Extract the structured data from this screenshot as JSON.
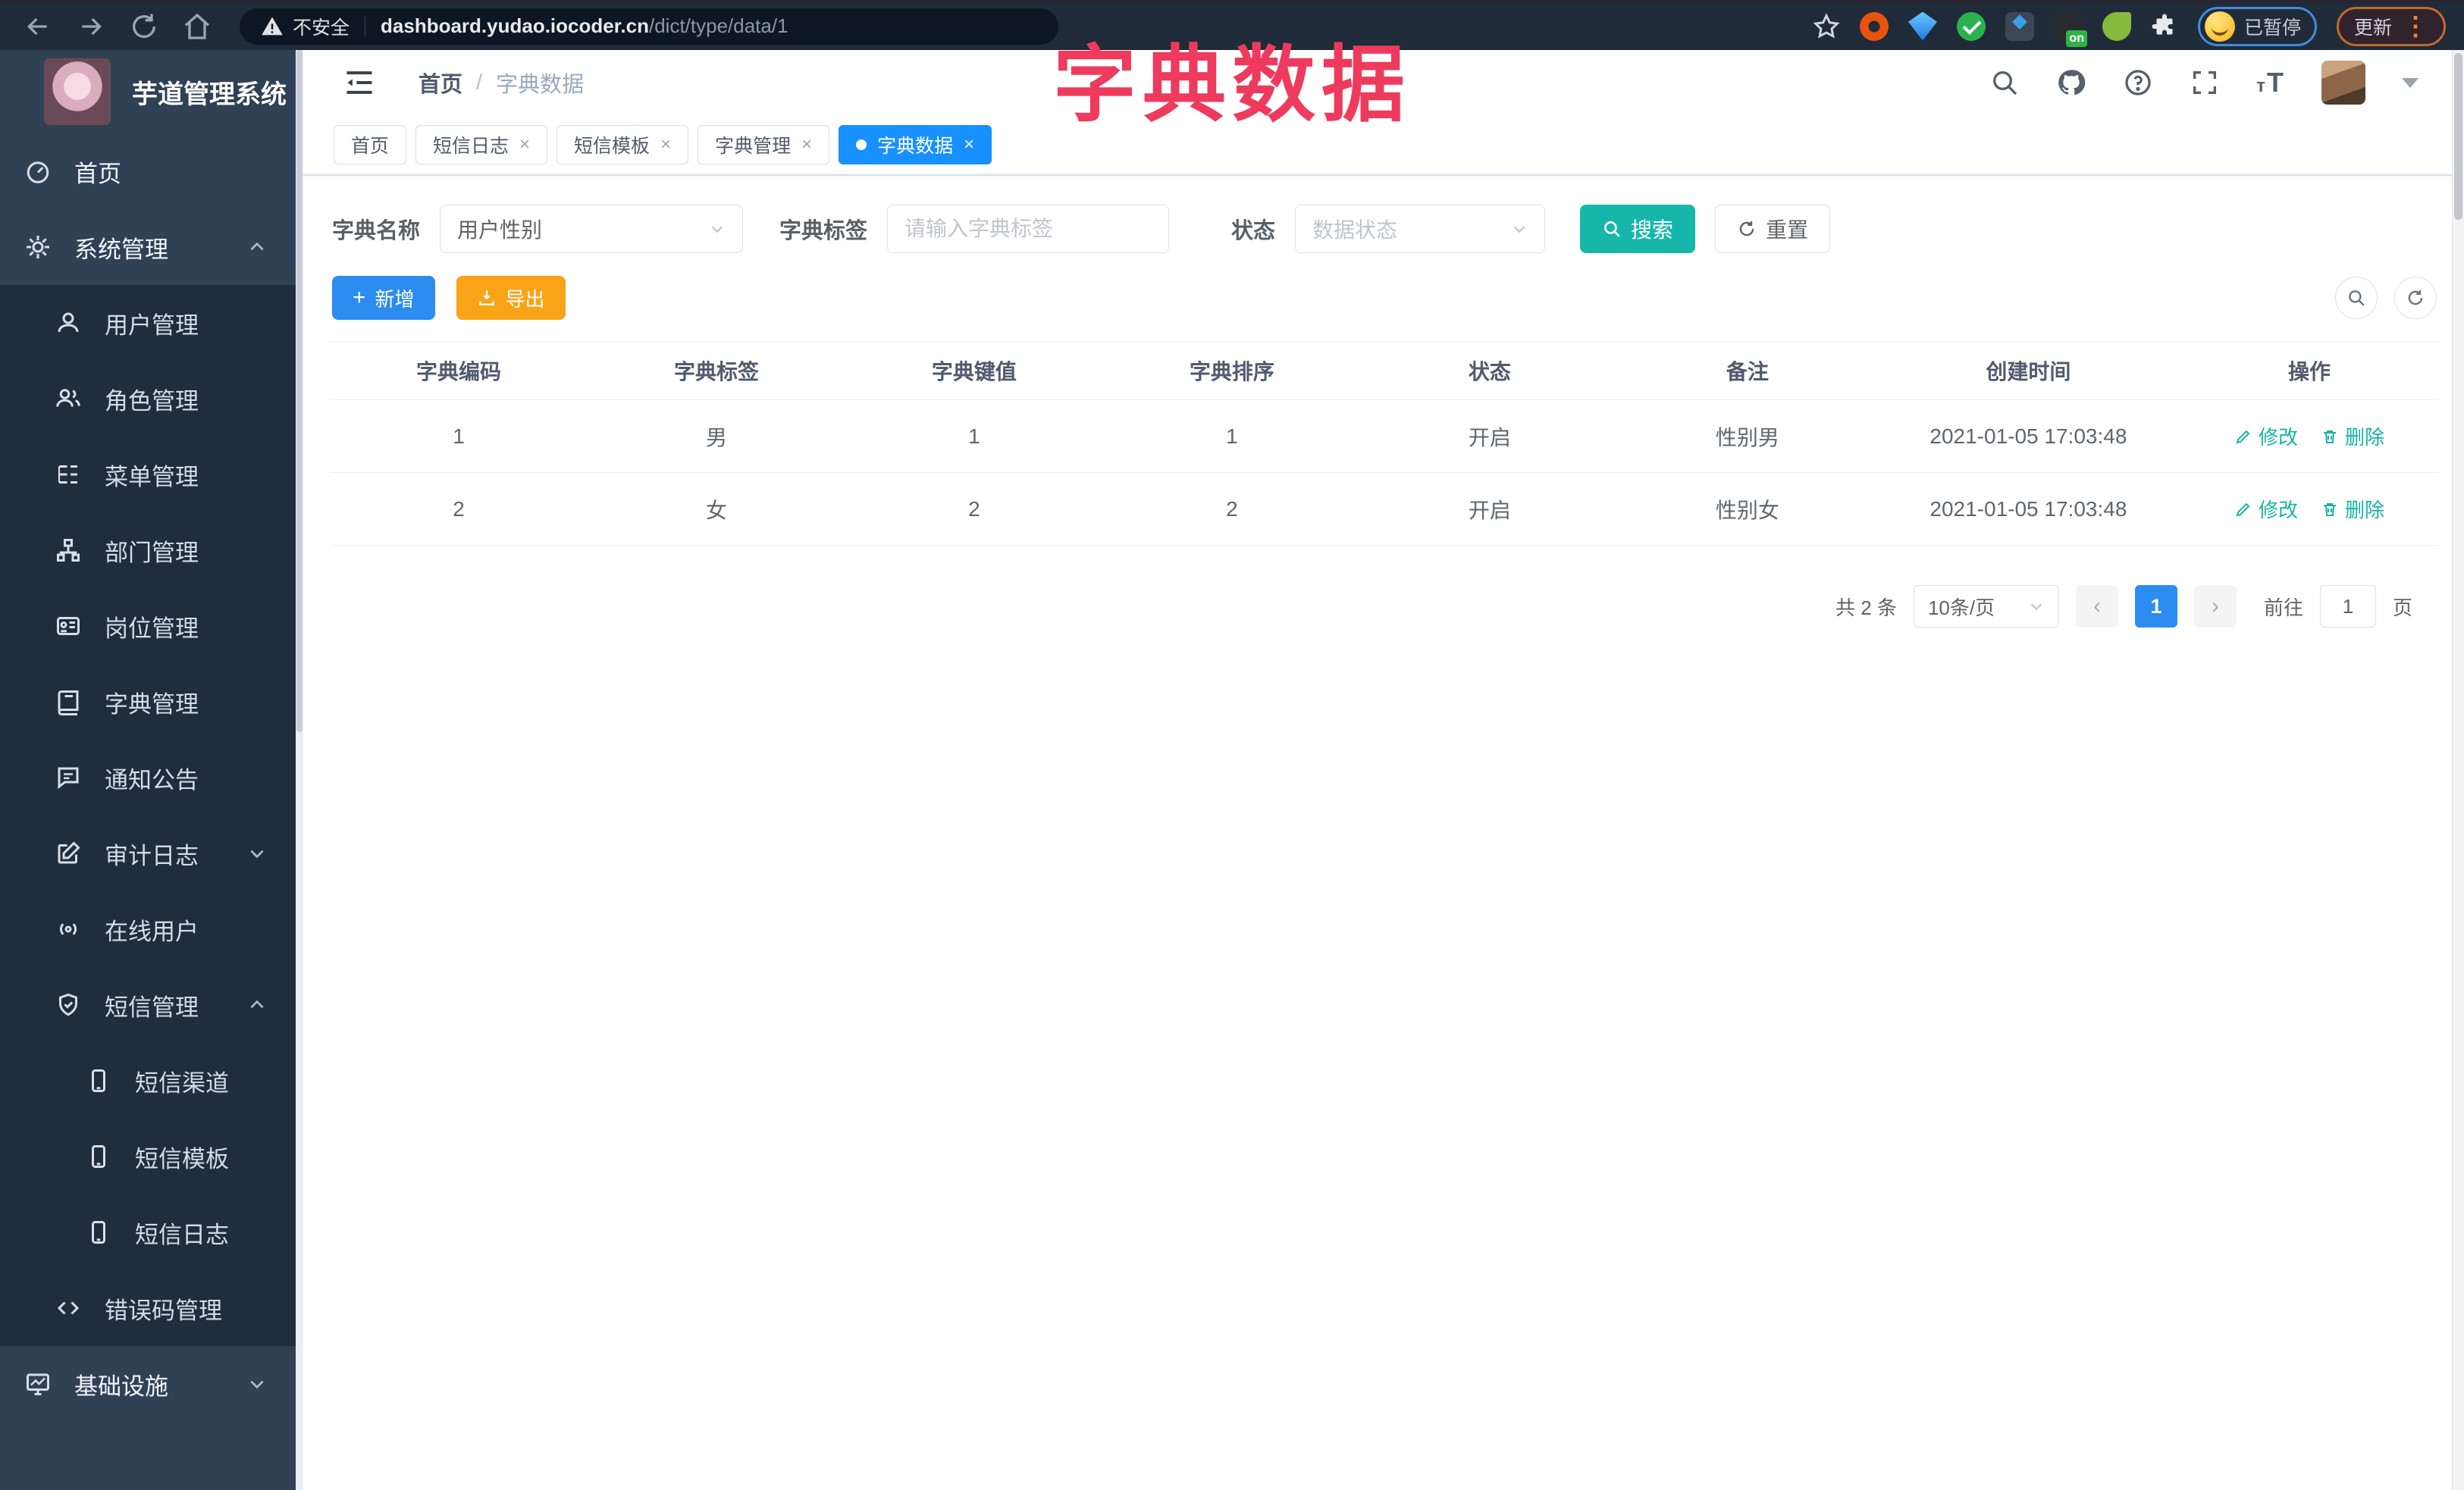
{
  "browser": {
    "security": "不安全",
    "url_host": "dashboard.yudao.iocoder.cn",
    "url_path": "/dict/type/data/1",
    "ext_on_badge": "on",
    "profile_status": "已暂停",
    "update_label": "更新"
  },
  "overlay_title": "字典数据",
  "sidebar": {
    "app_title": "芋道管理系统",
    "items": [
      {
        "label": "首页",
        "icon": "gauge-icon",
        "level": 1
      },
      {
        "label": "系统管理",
        "icon": "gear-icon",
        "level": 1,
        "state": "expanded"
      },
      {
        "label": "用户管理",
        "icon": "user-icon",
        "level": 2
      },
      {
        "label": "角色管理",
        "icon": "users-icon",
        "level": 2
      },
      {
        "label": "菜单管理",
        "icon": "menu-list-icon",
        "level": 2
      },
      {
        "label": "部门管理",
        "icon": "org-tree-icon",
        "level": 2
      },
      {
        "label": "岗位管理",
        "icon": "id-card-icon",
        "level": 2
      },
      {
        "label": "字典管理",
        "icon": "book-icon",
        "level": 2
      },
      {
        "label": "通知公告",
        "icon": "message-icon",
        "level": 2
      },
      {
        "label": "审计日志",
        "icon": "edit-note-icon",
        "level": 2,
        "state": "collapsed"
      },
      {
        "label": "在线用户",
        "icon": "online-signal-icon",
        "level": 2
      },
      {
        "label": "短信管理",
        "icon": "shield-check-icon",
        "level": 2,
        "state": "expanded"
      },
      {
        "label": "短信渠道",
        "icon": "phone-icon",
        "level": 3
      },
      {
        "label": "短信模板",
        "icon": "phone-icon",
        "level": 3
      },
      {
        "label": "短信日志",
        "icon": "phone-icon",
        "level": 3
      },
      {
        "label": "错误码管理",
        "icon": "code-icon",
        "level": 2
      },
      {
        "label": "基础设施",
        "icon": "monitor-icon",
        "level": 1,
        "state": "collapsed"
      }
    ]
  },
  "header": {
    "breadcrumb_home": "首页",
    "breadcrumb_sep": "/",
    "breadcrumb_current": "字典数据"
  },
  "tabs": [
    {
      "label": "首页",
      "closable": false,
      "active": false
    },
    {
      "label": "短信日志",
      "closable": true,
      "active": false
    },
    {
      "label": "短信模板",
      "closable": true,
      "active": false
    },
    {
      "label": "字典管理",
      "closable": true,
      "active": false
    },
    {
      "label": "字典数据",
      "closable": true,
      "active": true
    }
  ],
  "filters": {
    "name_label": "字典名称",
    "name_value": "用户性别",
    "tag_label": "字典标签",
    "tag_placeholder": "请输入字典标签",
    "status_label": "状态",
    "status_placeholder": "数据状态",
    "search_label": "搜索",
    "reset_label": "重置"
  },
  "toolbar": {
    "add_label": "新增",
    "export_label": "导出"
  },
  "table": {
    "columns": [
      "字典编码",
      "字典标签",
      "字典键值",
      "字典排序",
      "状态",
      "备注",
      "创建时间",
      "操作"
    ],
    "rows": [
      {
        "code": "1",
        "label": "男",
        "value": "1",
        "sort": "1",
        "status": "开启",
        "remark": "性别男",
        "created": "2021-01-05 17:03:48"
      },
      {
        "code": "2",
        "label": "女",
        "value": "2",
        "sort": "2",
        "status": "开启",
        "remark": "性别女",
        "created": "2021-01-05 17:03:48"
      }
    ],
    "edit_label": "修改",
    "delete_label": "删除"
  },
  "pagination": {
    "total": "共 2 条",
    "page_size": "10条/页",
    "current_page": "1",
    "goto_label": "前往",
    "goto_value": "1",
    "page_unit": "页"
  },
  "colors": {
    "primary_blue": "#2d8cf0",
    "tab_active_blue": "#1890ff",
    "search_teal": "#16b7aa",
    "action_teal": "#17b3a6",
    "export_orange": "#f9a316",
    "overlay_red": "#ee3a5c",
    "sidebar_bg": "#304156",
    "submenu_bg": "#1f2d3d",
    "chrome_bg": "#202b3a"
  }
}
